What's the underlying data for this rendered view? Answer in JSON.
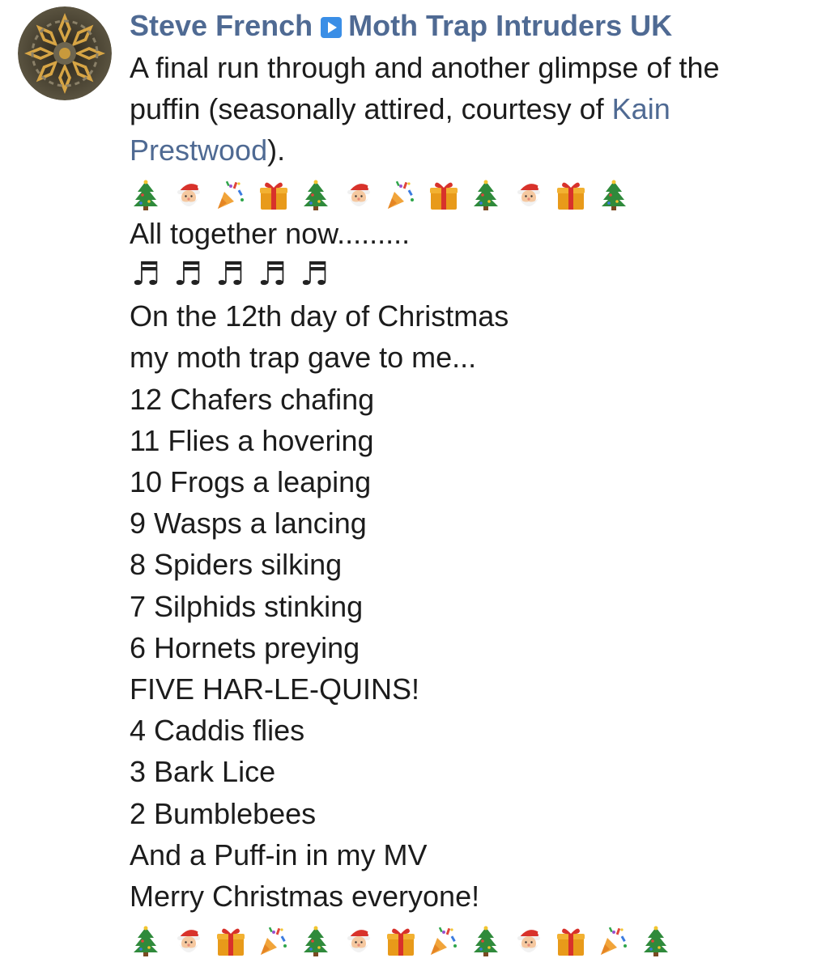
{
  "post": {
    "author": "Steve French",
    "group": "Moth Trap Intruders UK",
    "share_icon": "share-arrow-icon",
    "intro_before": "A final run through and another glimpse of the",
    "intro_line2": "puffin (seasonally attired, courtesy of ",
    "link_part1": "Kain",
    "link_part2": "Prestwood",
    "intro_after": ").",
    "emoji_row_1": [
      "tree",
      "santa",
      "popper",
      "gift",
      "tree",
      "santa",
      "popper",
      "gift",
      "tree",
      "santa",
      "gift",
      "tree"
    ],
    "together": "All together now.........",
    "notes": [
      "♬",
      "♬",
      "♬",
      "♬",
      "♬"
    ],
    "verse_lines": [
      "On the 12th day of Christmas",
      "my moth trap gave to me...",
      "12 Chafers chafing",
      "11 Flies a hovering",
      "10 Frogs a leaping",
      "9 Wasps a lancing",
      "8 Spiders silking",
      "7 Silphids stinking",
      "6 Hornets preying",
      "FIVE HAR-LE-QUINS!",
      "4 Caddis flies",
      "3 Bark Lice",
      "2 Bumblebees",
      "And a Puff-in in my MV",
      "Merry Christmas everyone!"
    ],
    "emoji_row_2": [
      "tree",
      "santa",
      "gift",
      "popper",
      "tree",
      "santa",
      "gift",
      "popper",
      "tree",
      "santa",
      "gift",
      "popper",
      "tree"
    ]
  },
  "colors": {
    "author_link": "#4f6a93",
    "text": "#1c1c1c",
    "share_badge": "#3a8ee6"
  }
}
